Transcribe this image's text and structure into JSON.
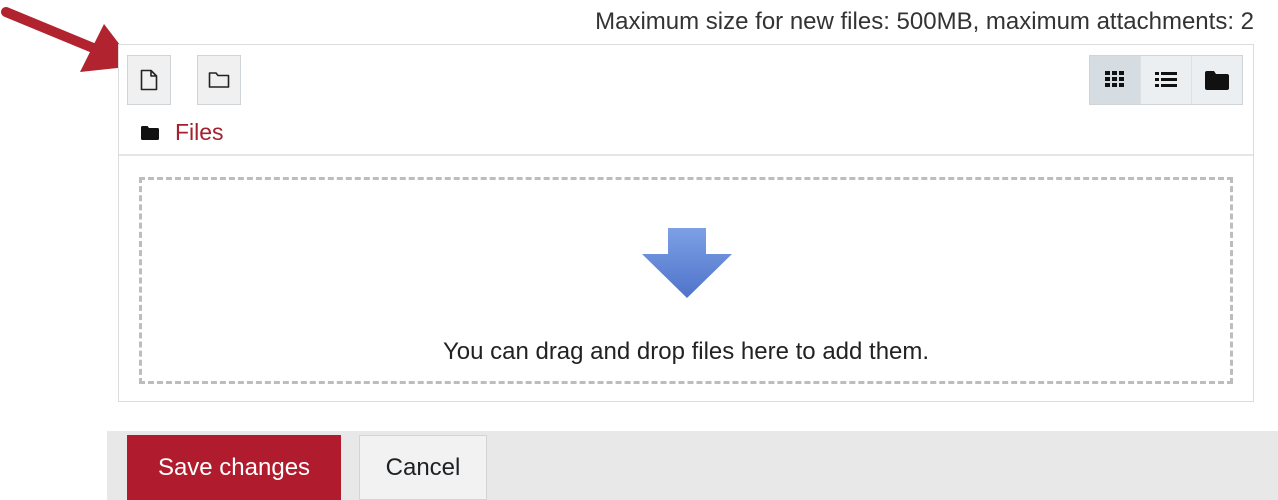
{
  "limits_text": "Maximum size for new files: 500MB, maximum attachments: 2",
  "toolbar": {
    "add_file_icon": "file-icon",
    "create_folder_icon": "folder-outline-icon",
    "views": [
      {
        "icon": "grid-icon",
        "active": true
      },
      {
        "icon": "list-icon",
        "active": false
      },
      {
        "icon": "folder-solid-icon",
        "active": false
      }
    ]
  },
  "path": {
    "folder_icon": "folder-solid-icon",
    "label": "Files"
  },
  "dropzone": {
    "text": "You can drag and drop files here to add them.",
    "icon": "down-arrow-icon"
  },
  "annotation": {
    "icon": "pointer-arrow-icon",
    "color": "#b0232f"
  },
  "footer": {
    "save_label": "Save changes",
    "cancel_label": "Cancel"
  },
  "colors": {
    "accent": "#b01c2e",
    "link": "#a5202e",
    "drop_arrow": "#5b7fd0"
  }
}
